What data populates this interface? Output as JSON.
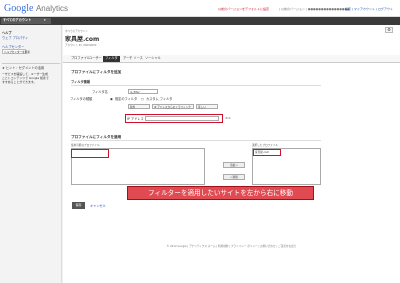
{
  "header": {
    "logo_google": "Google",
    "logo_analytics": "Analytics",
    "notice": "以前のバージョンをデフォルトに設定",
    "user_links": "| 以前のバージョン | ●●●●●●●●●●●●●●●●",
    "nav_links": "設定 | マイアカウント | ログアウト"
  },
  "account_bar": {
    "selected": "すべてのアカウント"
  },
  "sidebar": {
    "help_title": "ヘルプ",
    "help_item": "ウェブ プロパティ",
    "help_center": "ヘルプセンター",
    "help_button": "ヘルプセンターを検索",
    "tip_title": "★ ヒント：セグメントの活用",
    "tip_lines": [
      "ーザビスを開設して、ユーザー生成",
      "ことトコンテンツで Google 検索で",
      "すすめることができます。"
    ]
  },
  "property": {
    "breadcrumb": "すべてのアカウント",
    "name": "家具屋.com",
    "account_label": "アカウント ID: 00000000",
    "gear": "⚙"
  },
  "tabs": [
    "プロファイル",
    "ユーザー",
    "フィルタ",
    "アーチ ソース",
    "ソーシャル"
  ],
  "active_tab_index": 2,
  "form": {
    "title": "プロファイルにフィルタを追加",
    "filter_info": "フィルタ情報",
    "filter_name_label": "フィルタ名",
    "filter_name_value": "ip_filter",
    "filter_type_label": "フィルタの種類",
    "type_predefined": "既定のフィルタ",
    "type_custom": "カスタム フィルタ",
    "rule_select_1": "除外",
    "rule_select_2": "IP アドレスからのトラフィック",
    "rule_select_3": "等しい",
    "ip_label": "IP アドレス",
    "ip_hint": "IPv6",
    "apply_title": "プロファイルにフィルタを適用",
    "available_label": "使用可能なプロファイル",
    "selected_label": "選択したプロファイル",
    "selected_item": "家具屋.com",
    "add_button": "追加 »",
    "remove_button": "« 削除"
  },
  "annotation": "フィルターを適用したいサイトを左から右に移動",
  "actions": {
    "save": "保存",
    "cancel": "キャンセル"
  },
  "footer": "© 2012 Google | アナリティクス ホーム | 利用規約 | プライバシー ポリシー | お問い合わせ | ご意見をお送り"
}
